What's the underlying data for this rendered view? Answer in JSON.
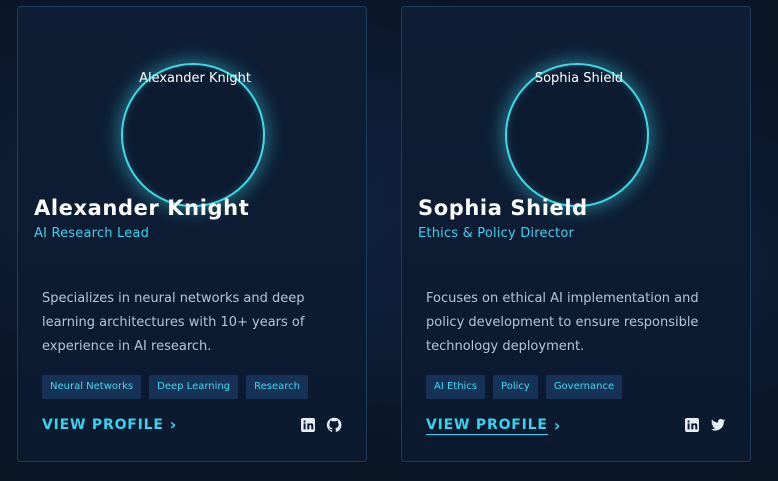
{
  "members": [
    {
      "avatar_alt": "Alexander Knight",
      "name": "Alexander Knight",
      "role": "AI Research Lead",
      "bio": "Specializes in neural networks and deep learning architectures with 10+ years of experience in AI research.",
      "tags": [
        "Neural Networks",
        "Deep Learning",
        "Research"
      ],
      "view_label": "VIEW PROFILE",
      "socials": [
        "linkedin-icon",
        "github-icon"
      ]
    },
    {
      "avatar_alt": "Sophia Shield",
      "name": "Sophia Shield",
      "role": "Ethics & Policy Director",
      "bio": "Focuses on ethical AI implementation and policy development to ensure responsible technology deployment.",
      "tags": [
        "AI Ethics",
        "Policy",
        "Governance"
      ],
      "view_label": "VIEW PROFILE",
      "socials": [
        "linkedin-icon",
        "twitter-icon"
      ]
    }
  ],
  "colors": {
    "accent": "#36d2f0",
    "ring": "#3fd9e6",
    "tag_bg": "#173257",
    "card_bg": "#0e1d35"
  }
}
